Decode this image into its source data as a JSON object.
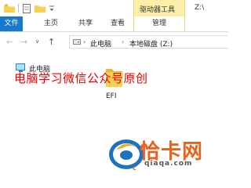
{
  "title_bar": {
    "context_tools_label": "驱动器工具",
    "window_title": "Z:\\"
  },
  "ribbon": {
    "tabs": [
      {
        "label": "文件"
      },
      {
        "label": "主页"
      },
      {
        "label": "共享"
      },
      {
        "label": "查看"
      },
      {
        "label": "管理"
      }
    ]
  },
  "address": {
    "breadcrumbs": [
      {
        "label": "此电脑"
      },
      {
        "label": "本地磁盘 (Z:)"
      }
    ]
  },
  "nav_pane": {
    "items": [
      {
        "label": "此电脑",
        "icon": "computer-icon"
      }
    ]
  },
  "content": {
    "items": [
      {
        "label": "EFI",
        "icon": "folder-icon"
      }
    ]
  },
  "overlay": {
    "watermark_text": "电脑学习微信公众号原创"
  },
  "logo": {
    "name": "恰卡网",
    "url": "qiaqa.com"
  },
  "colors": {
    "file_tab": "#1979ca",
    "context_tab": "#fcefa9",
    "watermark": "#e60000",
    "logo_orange": "#e8621c",
    "folder": "#f7cf52"
  }
}
